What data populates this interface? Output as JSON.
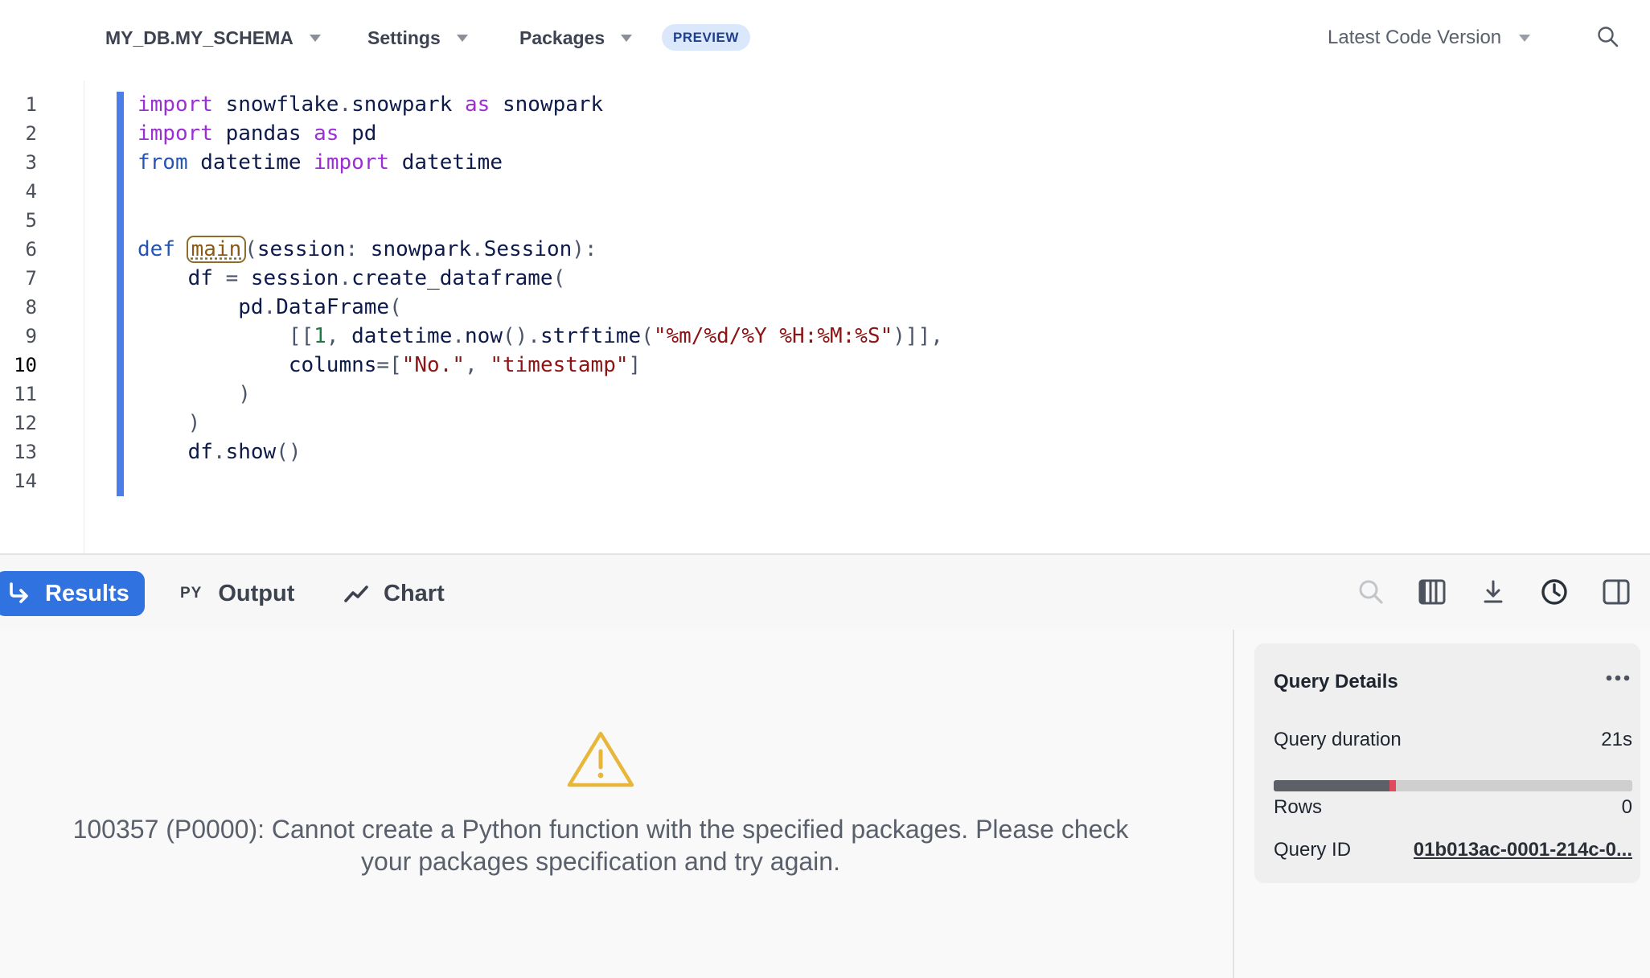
{
  "toolbar": {
    "schema": "MY_DB.MY_SCHEMA",
    "settings": "Settings",
    "packages": "Packages",
    "preview_badge": "PREVIEW",
    "version": "Latest Code Version"
  },
  "editor": {
    "line_numbers": [
      "1",
      "2",
      "3",
      "4",
      "5",
      "6",
      "7",
      "8",
      "9",
      "10",
      "11",
      "12",
      "13",
      "14"
    ],
    "active_line": 10,
    "code": {
      "l1": {
        "k1": "import",
        "n1": " snowflake",
        "o1": ".",
        "n2": "snowpark",
        "k2": " as",
        "n3": " snowpark"
      },
      "l2": {
        "k1": "import",
        "n1": " pandas",
        "k2": " as",
        "n2": " pd"
      },
      "l3": {
        "k1": "from",
        "n1": " datetime",
        "k2": " import",
        "n2": " datetime"
      },
      "l6": {
        "k1": "def",
        "fn": "main",
        "o1": "(",
        "n1": "session",
        "o2": ": ",
        "n2": "snowpark",
        "o3": ".",
        "n3": "Session",
        "o4": "):"
      },
      "l7": {
        "n1": "    df",
        "o1": " = ",
        "n2": "session",
        "o2": ".",
        "n3": "create_dataframe",
        "o3": "("
      },
      "l8": {
        "n1": "        pd",
        "o1": ".",
        "n2": "DataFrame",
        "o2": "("
      },
      "l9": {
        "o1": "            [[",
        "num": "1",
        "o2": ", ",
        "n1": "datetime",
        "o3": ".",
        "n2": "now",
        "o4": "().",
        "n3": "strftime",
        "o5": "(",
        "s1": "\"%m/%d/%Y %H:%M:%S\"",
        "o6": ")]],"
      },
      "l10": {
        "n1": "            columns",
        "o1": "=[",
        "s1": "\"No.\"",
        "o2": ", ",
        "s2": "\"timestamp\"",
        "o3": "]"
      },
      "l11": {
        "o1": "        )"
      },
      "l12": {
        "o1": "    )"
      },
      "l13": {
        "n1": "    df",
        "o1": ".",
        "n2": "show",
        "o2": "()"
      }
    }
  },
  "results_bar": {
    "tabs": {
      "results": "Results",
      "output_tag": "PY",
      "output": "Output",
      "chart": "Chart"
    }
  },
  "error": {
    "message": "100357 (P0000): Cannot create a Python function with the specified packages. Please check your packages specification and try again."
  },
  "query_details": {
    "title": "Query Details",
    "duration_label": "Query duration",
    "duration_value": "21s",
    "duration_fraction": 0.34,
    "rows_label": "Rows",
    "rows_value": "0",
    "query_id_label": "Query ID",
    "query_id_value": "01b013ac-0001-214c-0..."
  },
  "colors": {
    "accent": "#2f72e0",
    "change_bar": "#4c7de8",
    "warning": "#e8b73a",
    "duration_marker": "#e04a5a"
  },
  "icons": [
    "caret-down-icon",
    "search-icon",
    "return-arrow-icon",
    "line-chart-icon",
    "columns-icon",
    "download-icon",
    "history-icon",
    "split-panel-icon",
    "warning-icon",
    "more-icon"
  ]
}
